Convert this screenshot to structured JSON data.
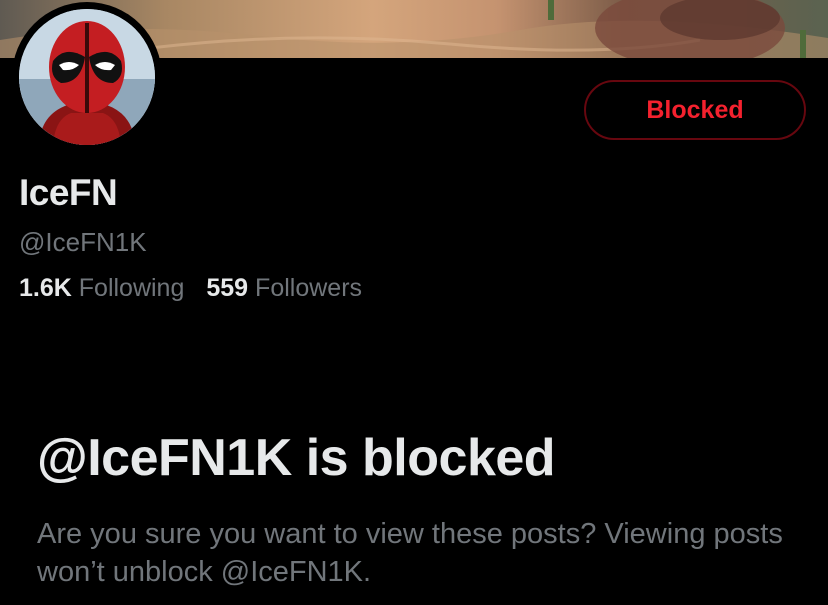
{
  "profile": {
    "display_name": "IceFN",
    "handle": "@IceFN1K",
    "following_count": "1.6K",
    "following_label": "Following",
    "followers_count": "559",
    "followers_label": "Followers",
    "avatar_icon": "deadpool-avatar"
  },
  "actions": {
    "blocked_label": "Blocked"
  },
  "blocked_notice": {
    "title": "@IceFN1K is blocked",
    "description": "Are you sure you want to view these posts? Viewing posts won’t unblock @IceFN1K."
  },
  "colors": {
    "background": "#000000",
    "primary_text": "#e7e9ea",
    "secondary_text": "#71767b",
    "blocked_red": "#f4212e",
    "blocked_border": "#67070f"
  }
}
